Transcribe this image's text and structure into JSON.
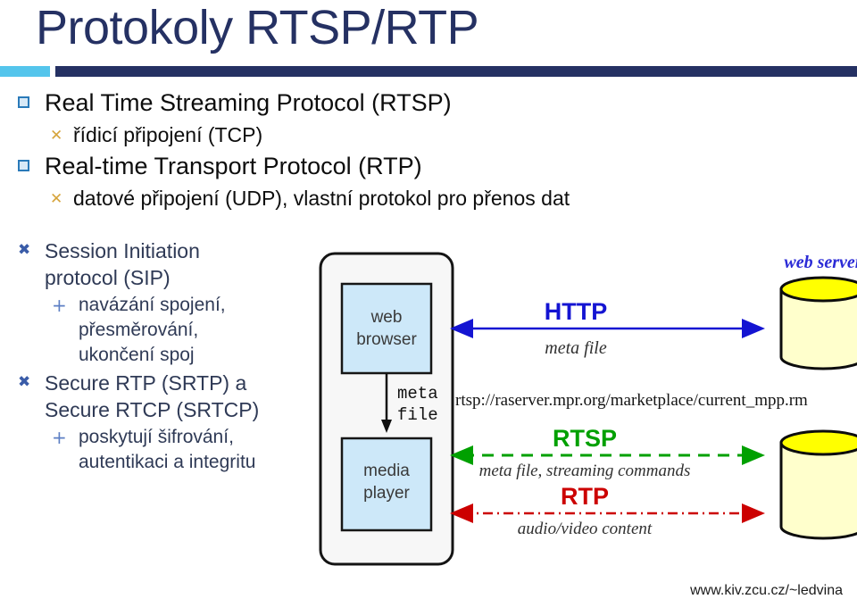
{
  "slide": {
    "title": "Protokoly RTSP/RTP",
    "footer_url": "www.kiv.zcu.cz/~ledvina"
  },
  "colors": {
    "title": "#253163",
    "accent_light": "#54c5ec",
    "accent_dark": "#253163",
    "bullet_lvl1": "#2a7ab9",
    "bullet_lvl2": "#d6a43b",
    "bullet_blue_x": "#3a5ca8",
    "bullet_blue_plus": "#5d7fc4",
    "http": "#1414d2",
    "rtsp": "#00a000",
    "rtp": "#cc0000",
    "client_box": "#f7f7f7",
    "inner_box": "#cde8f9",
    "cylinder_top": "#ffff00",
    "cylinder_body": "#ffffcc"
  },
  "bullets": [
    {
      "level": 1,
      "mark": "hollow-square",
      "text": "Real Time Streaming Protocol (RTSP)"
    },
    {
      "level": 2,
      "mark": "x",
      "text": "řídicí připojení (TCP)"
    },
    {
      "level": 1,
      "mark": "hollow-square",
      "text": "Real-time Transport Protocol (RTP)"
    },
    {
      "level": 2,
      "mark": "x",
      "text": "datové připojení (UDP), vlastní protokol pro přenos dat"
    }
  ],
  "narrow_bullets": [
    {
      "level": 2,
      "mark": "x",
      "lines": [
        "Session Initiation",
        "protocol (SIP)"
      ]
    },
    {
      "level": 3,
      "mark": "plus",
      "lines": [
        "navázání spojení,",
        "přesměrování,",
        "ukončení spoj"
      ]
    },
    {
      "level": 2,
      "mark": "x",
      "lines": [
        "Secure RTP (SRTP) a",
        "Secure RTCP (SRTCP)"
      ]
    },
    {
      "level": 3,
      "mark": "plus",
      "lines": [
        "poskytují šifrování,",
        "autentikaci a integritu"
      ]
    }
  ],
  "marks": {
    "x": "✖",
    "x_small": "✕",
    "plus": "+"
  },
  "diagram": {
    "client_boxes": {
      "browser": [
        "web",
        "browser"
      ],
      "player": [
        "media",
        "player"
      ]
    },
    "internal_arrow_label": [
      "meta",
      "file"
    ],
    "url": "rtsp://raserver.mpr.org/marketplace/current_mpp.rm",
    "server_label": "web server",
    "flows": [
      {
        "name": "http",
        "protocol": "HTTP",
        "caption": "meta file",
        "style": "solid"
      },
      {
        "name": "rtsp",
        "protocol": "RTSP",
        "caption": "meta file, streaming commands",
        "style": "dashed"
      },
      {
        "name": "rtp",
        "protocol": "RTP",
        "caption": "audio/video content",
        "style": "dashdot"
      }
    ]
  }
}
